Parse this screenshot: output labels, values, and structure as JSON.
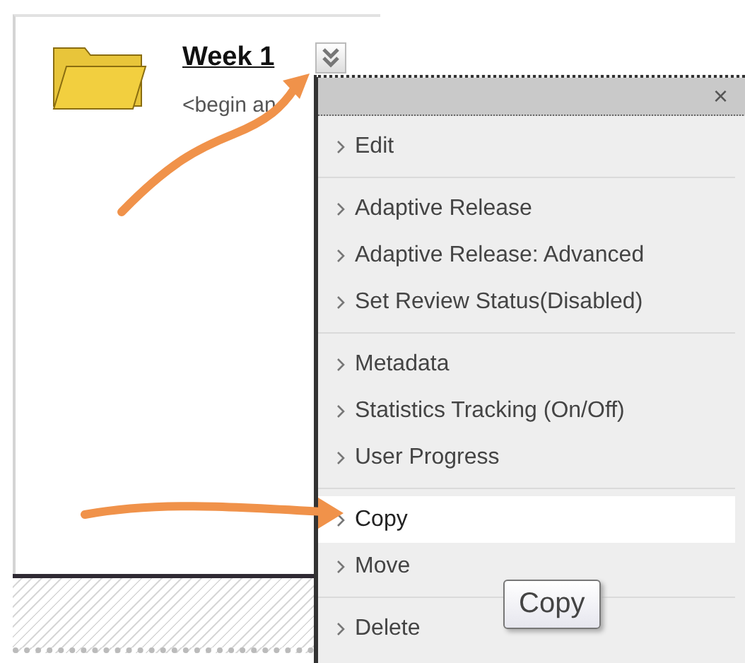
{
  "content_item": {
    "title": "Week 1",
    "description": "<begin an"
  },
  "context_menu": {
    "close": "×",
    "groups": [
      {
        "items": [
          {
            "label": "Edit",
            "selected": false
          }
        ]
      },
      {
        "items": [
          {
            "label": "Adaptive Release",
            "selected": false
          },
          {
            "label": "Adaptive Release: Advanced",
            "selected": false
          },
          {
            "label": "Set Review Status(Disabled)",
            "selected": false
          }
        ]
      },
      {
        "items": [
          {
            "label": "Metadata",
            "selected": false
          },
          {
            "label": "Statistics Tracking (On/Off)",
            "selected": false
          },
          {
            "label": "User Progress",
            "selected": false
          }
        ]
      },
      {
        "items": [
          {
            "label": "Copy",
            "selected": true
          },
          {
            "label": "Move",
            "selected": false
          }
        ]
      },
      {
        "items": [
          {
            "label": "Delete",
            "selected": false
          }
        ]
      }
    ]
  },
  "tooltip": "Copy"
}
